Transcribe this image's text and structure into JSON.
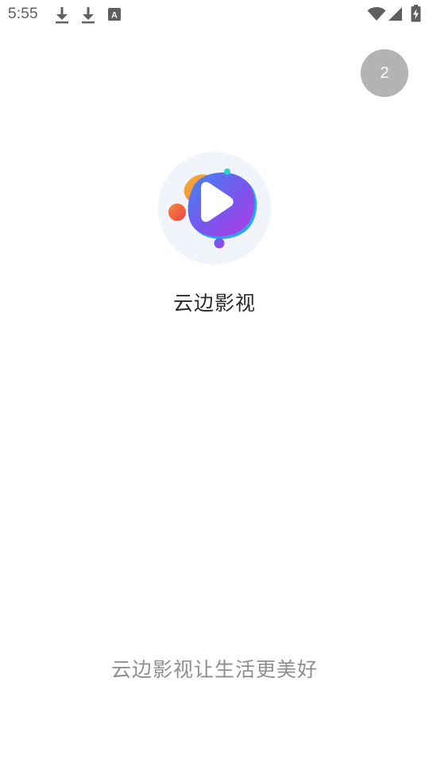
{
  "status_bar": {
    "time": "5:55",
    "icons": [
      "download-icon",
      "download-icon",
      "text-badge-icon",
      "wifi-icon",
      "signal-icon",
      "battery-charging-icon"
    ],
    "badge_letter": "A"
  },
  "splash": {
    "countdown": "2",
    "app_name": "云边影视",
    "slogan": "云边影视让生活更美好",
    "logo_icon": "play-logo-icon"
  },
  "colors": {
    "countdown_bg": "#b3b3b3",
    "logo_circle": "#f2f5fb",
    "logo_blue": "#4a73f0",
    "logo_purple": "#a43be6",
    "logo_orange": "#f2a03a",
    "logo_red": "#f05a3c",
    "logo_cyan": "#2ad0c6"
  }
}
